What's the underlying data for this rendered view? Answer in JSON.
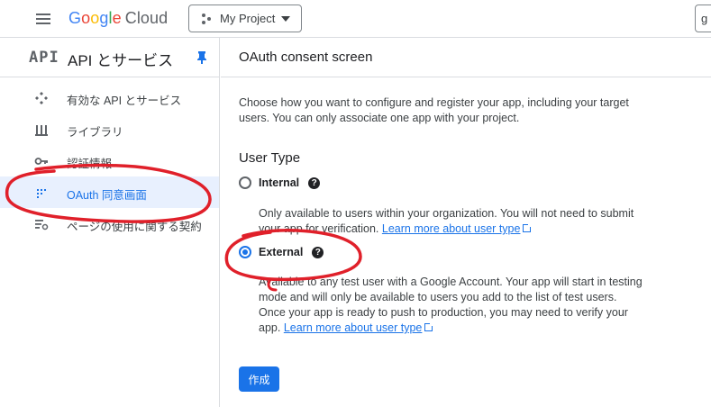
{
  "topbar": {
    "logo_google": [
      "G",
      "o",
      "o",
      "g",
      "l",
      "e"
    ],
    "logo_cloud": "Cloud",
    "project_label": "My Project",
    "search_partial": "g"
  },
  "sidebar": {
    "api_logo": "API",
    "title": "API とサービス",
    "items": [
      {
        "label": "有効な API とサービス",
        "icon": "services-icon"
      },
      {
        "label": "ライブラリ",
        "icon": "library-icon"
      },
      {
        "label": "認証情報",
        "icon": "key-icon"
      },
      {
        "label": "OAuth 同意画面",
        "icon": "consent-icon",
        "active": true
      },
      {
        "label": "ページの使用に関する契約",
        "icon": "agreements-icon"
      }
    ]
  },
  "main": {
    "title": "OAuth consent screen",
    "description": "Choose how you want to configure and register your app, including your target users. You can only associate one app with your project.",
    "user_type_heading": "User Type",
    "options": [
      {
        "label": "Internal",
        "checked": false,
        "description": "Only available to users within your organization. You will not need to submit your app for verification.",
        "link": "Learn more about user type"
      },
      {
        "label": "External",
        "checked": true,
        "description": "Available to any test user with a Google Account. Your app will start in testing mode and will only be available to users you add to the list of test users. Once your app is ready to push to production, you may need to verify your app.",
        "link": "Learn more about user type"
      }
    ],
    "help_glyph": "?",
    "create_label": "作成"
  },
  "colors": {
    "accent": "#1a73e8",
    "annotation": "#e0202a"
  }
}
